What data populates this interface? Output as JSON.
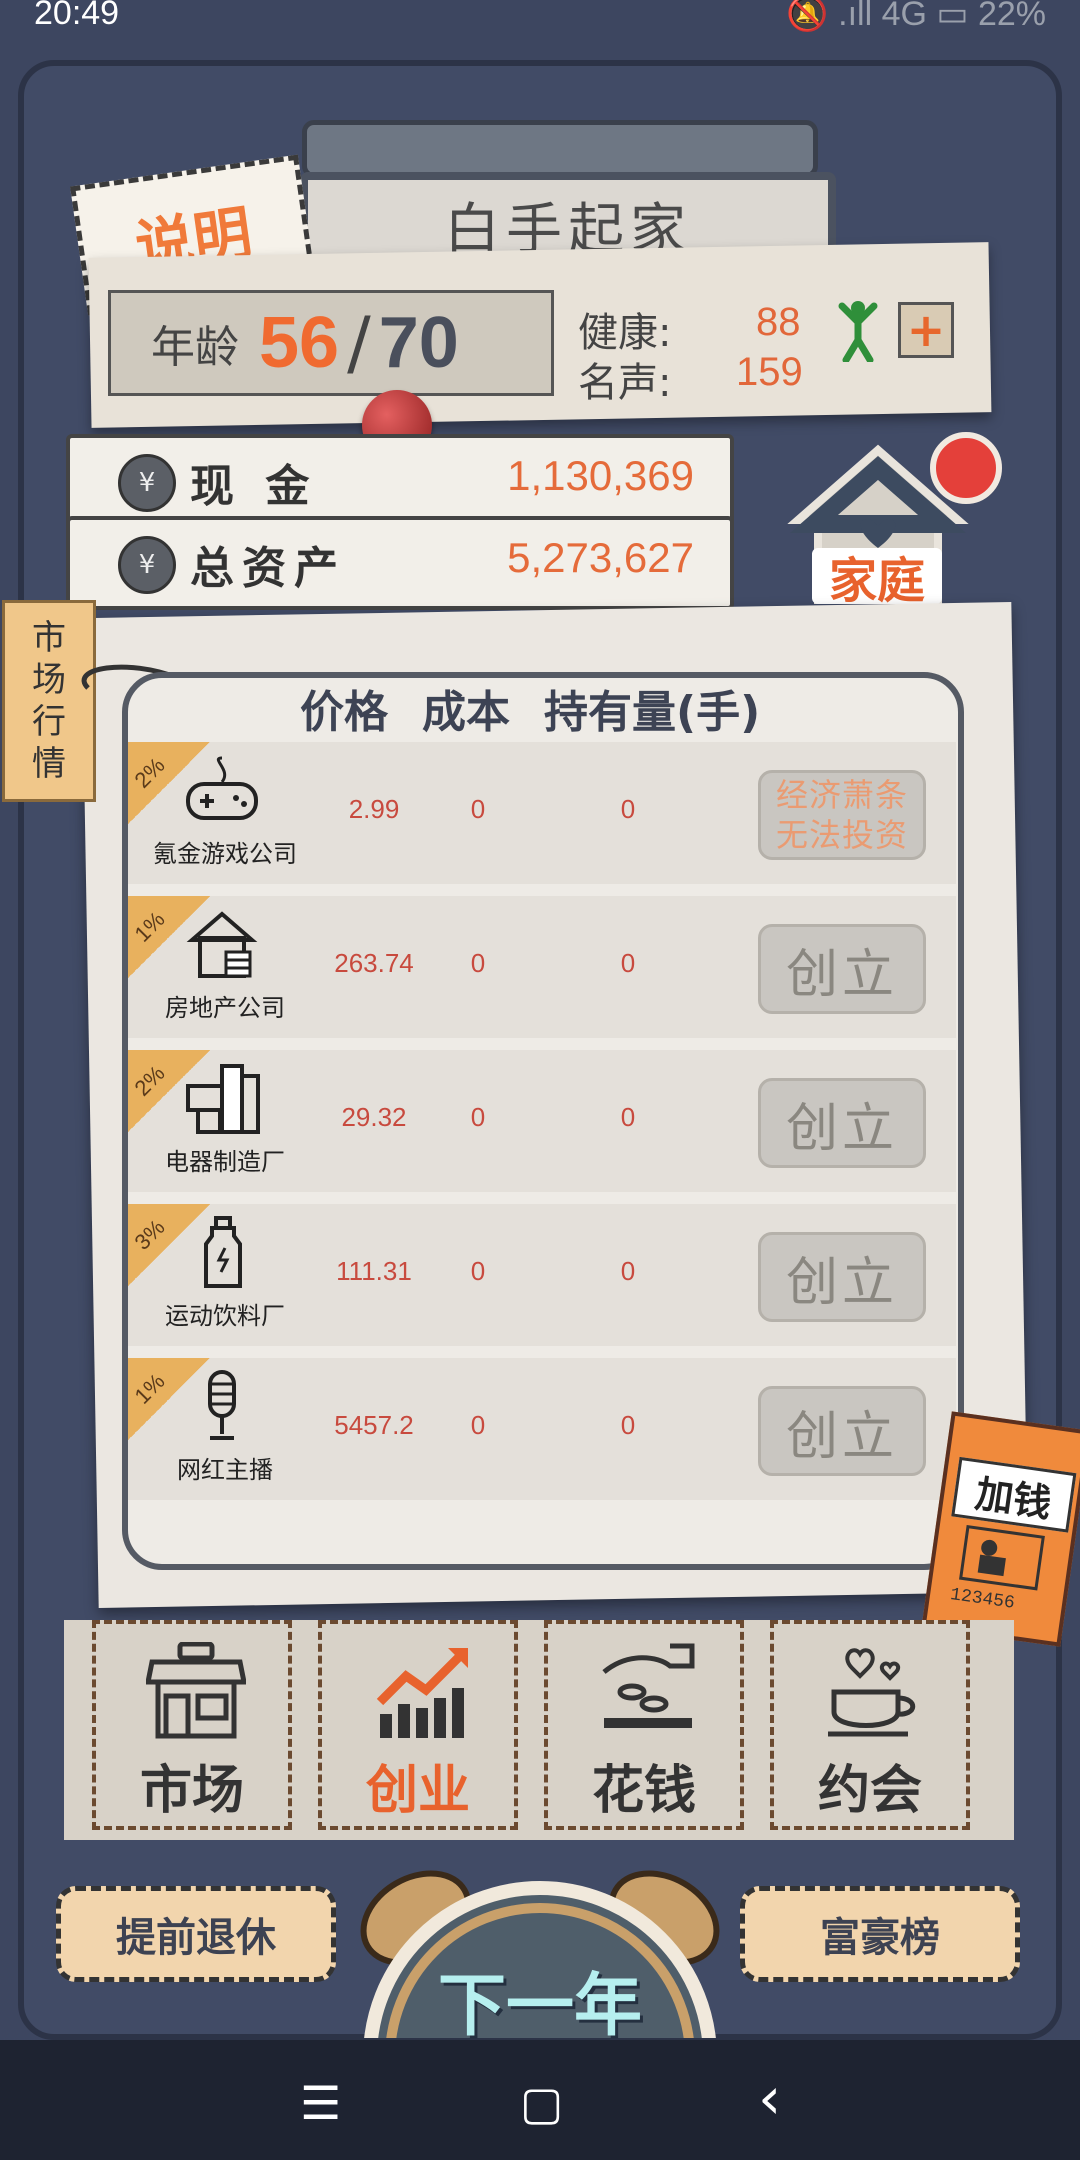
{
  "status_bar": {
    "time": "20:49",
    "right": "🔕 .ıll 4G ▭ 22%"
  },
  "header": {
    "title": "白手起家",
    "help_label": "说明"
  },
  "stats": {
    "age_label": "年龄",
    "age": "56",
    "age_separator": "/",
    "age_max": "70",
    "health_label": "健康:",
    "health": "88",
    "fame_label": "名声:",
    "fame": "159",
    "plus_label": "+"
  },
  "finance": {
    "cash_label": "现 金",
    "cash": "1,130,369",
    "assets_label": "总资产",
    "assets": "5,273,627",
    "coin_symbol": "¥"
  },
  "family": {
    "label": "家庭"
  },
  "market_tag": {
    "chars": [
      "市",
      "场",
      "行",
      "情"
    ]
  },
  "table": {
    "headers": [
      "价格",
      "成本",
      "持有量(手)"
    ],
    "rows": [
      {
        "badge": "2%",
        "name": "氪金游戏公司",
        "price": "2.99",
        "cost": "0",
        "hold": "0",
        "button": "经济萧条",
        "button2": "无法投资",
        "icon": "gamepad-icon"
      },
      {
        "badge": "1%",
        "name": "房地产公司",
        "price": "263.74",
        "cost": "0",
        "hold": "0",
        "button": "创立",
        "icon": "house-icon"
      },
      {
        "badge": "2%",
        "name": "电器制造厂",
        "price": "29.32",
        "cost": "0",
        "hold": "0",
        "button": "创立",
        "icon": "appliance-icon"
      },
      {
        "badge": "3%",
        "name": "运动饮料厂",
        "price": "111.31",
        "cost": "0",
        "hold": "0",
        "button": "创立",
        "icon": "bottle-icon"
      },
      {
        "badge": "1%",
        "name": "网红主播",
        "price": "5457.2",
        "cost": "0",
        "hold": "0",
        "button": "创立",
        "icon": "microphone-icon"
      }
    ]
  },
  "ticket": {
    "label": "加钱",
    "number": "123456"
  },
  "tabs": [
    {
      "label": "市场",
      "icon": "shop-icon",
      "active": false
    },
    {
      "label": "创业",
      "icon": "growth-chart-icon",
      "active": true
    },
    {
      "label": "花钱",
      "icon": "hand-coins-icon",
      "active": false
    },
    {
      "label": "约会",
      "icon": "coffee-cup-icon",
      "active": false
    }
  ],
  "bottom": {
    "retire": "提前退休",
    "rich_list": "富豪榜",
    "next_year": "下一年"
  },
  "navbar": {
    "menu": "☰",
    "home": "▢",
    "back": "‹"
  },
  "colors": {
    "accent": "#e8622d",
    "frame": "#3d4660",
    "paper": "#ebe7e1"
  }
}
